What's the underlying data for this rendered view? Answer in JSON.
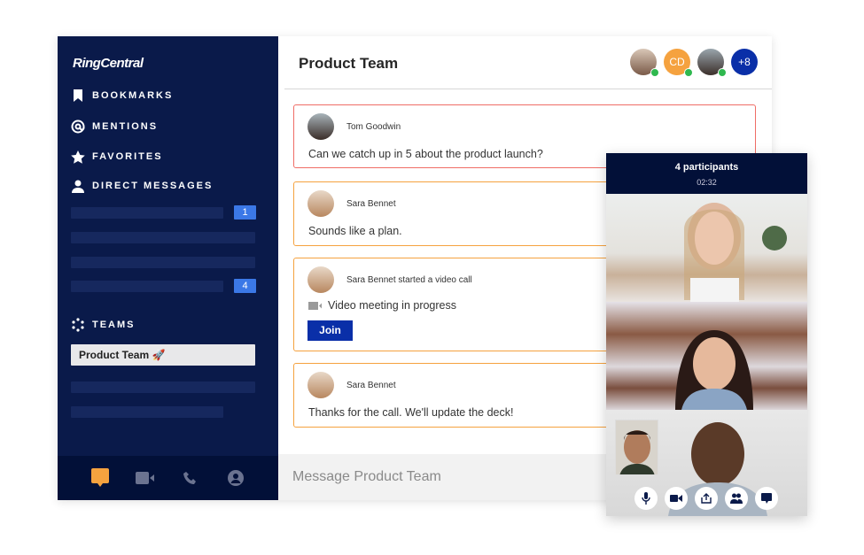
{
  "sidebar": {
    "logo": "RingCentral",
    "nav": [
      {
        "label": "BOOKMARKS",
        "icon": "bookmark-icon"
      },
      {
        "label": "MENTIONS",
        "icon": "at-icon"
      },
      {
        "label": "FAVORITES",
        "icon": "star-icon"
      },
      {
        "label": "DIRECT MESSAGES",
        "icon": "person-icon"
      }
    ],
    "direct_message_badges": [
      "1",
      "4"
    ],
    "teams_label": "TEAMS",
    "selected_team": "Product Team 🚀",
    "footer_icons": [
      "message-icon",
      "video-icon",
      "phone-icon",
      "contacts-icon"
    ],
    "accent_color": "#f5a23f"
  },
  "header": {
    "title": "Product Team",
    "avatar_initials": "CD",
    "more_count": "+8"
  },
  "messages": [
    {
      "author": "Tom Goodwin",
      "text": "Can we catch up in 5 about the product launch?"
    },
    {
      "author": "Sara Bennet",
      "text": "Sounds like a plan."
    },
    {
      "author": "Sara Bennet started a video call",
      "text": "Video meeting in progress",
      "button": "Join"
    },
    {
      "author": "Sara Bennet",
      "text": "Thanks for the call. We'll update the deck!"
    }
  ],
  "composer": {
    "placeholder": "Message Product Team"
  },
  "video_call": {
    "participants": "4 participants",
    "duration": "02:32",
    "controls": [
      "microphone-icon",
      "camera-icon",
      "share-screen-icon",
      "participants-icon",
      "chat-icon"
    ]
  }
}
